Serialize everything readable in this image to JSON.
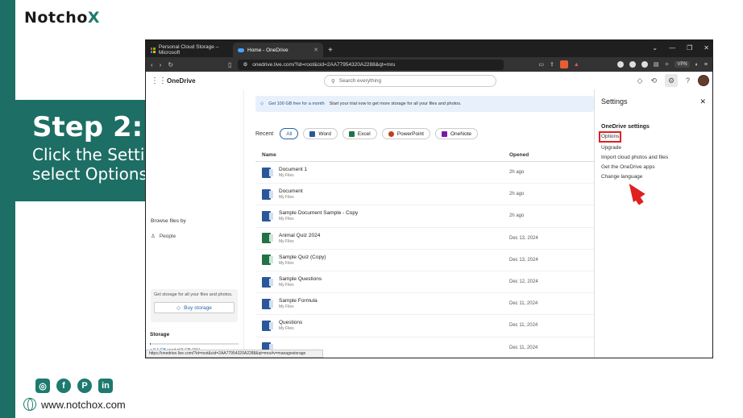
{
  "brand": {
    "name_prefix": "Notcho",
    "name_suffix": "X"
  },
  "step": {
    "title": "Step 2:",
    "description": "Click the Settings and select Options"
  },
  "social": {
    "icons": [
      "instagram-icon",
      "facebook-icon",
      "pinterest-icon",
      "linkedin-icon"
    ],
    "pinterest_glyph": "P",
    "linkedin_glyph": "in",
    "instagram_glyph": "◎",
    "facebook_glyph": "f"
  },
  "website": "www.notchox.com",
  "browser": {
    "tabs": [
      {
        "label": "Personal Cloud Storage – Microsoft"
      },
      {
        "label": "Home - OneDrive"
      }
    ],
    "new_tab": "+",
    "url": "onedrive.live.com/?id=root&cid=2AA77954320A2288&qt=mru",
    "vpn": "VPN",
    "status_url": "https://onedrive.live.com/?id=root&cid=2AA77954320A2288&qt=mru#v=managestorage"
  },
  "onedrive": {
    "app_title": "OneDrive",
    "search_placeholder": "Search everything",
    "banner": {
      "highlight": "Get 100 GB free for a month",
      "text": "Start your trial now to get more storage for all your files and photos."
    },
    "filters": {
      "recent_label": "Recent",
      "chips": [
        {
          "label": "All",
          "color": ""
        },
        {
          "label": "Word",
          "color": "#2b579a"
        },
        {
          "label": "Excel",
          "color": "#217346"
        },
        {
          "label": "PowerPoint",
          "color": "#c43e1c"
        },
        {
          "label": "OneNote",
          "color": "#7719aa"
        }
      ]
    },
    "columns": {
      "name": "Name",
      "opened": "Opened"
    },
    "files": [
      {
        "name": "Document 1",
        "location": "My Files",
        "opened": "2h ago",
        "type": "word"
      },
      {
        "name": "Document",
        "location": "My Files",
        "opened": "2h ago",
        "type": "word"
      },
      {
        "name": "Sample Document Sample - Copy",
        "location": "My Files",
        "opened": "2h ago",
        "type": "word"
      },
      {
        "name": "Animal Quiz 2024",
        "location": "My Files",
        "opened": "Dec 13, 2024",
        "type": "excel"
      },
      {
        "name": "Sample Quiz (Copy)",
        "location": "My Files",
        "opened": "Dec 13, 2024",
        "type": "excel"
      },
      {
        "name": "Sample Questions",
        "location": "My Files",
        "opened": "Dec 12, 2024",
        "type": "word"
      },
      {
        "name": "Sample Formula",
        "location": "My Files",
        "opened": "Dec 11, 2024",
        "type": "word"
      },
      {
        "name": "Questions",
        "location": "My Files",
        "opened": "Dec 11, 2024",
        "type": "word"
      },
      {
        "name": "",
        "location": "",
        "opened": "Dec 11, 2024",
        "type": "word"
      }
    ],
    "sidebar": {
      "browse_heading": "Browse files by",
      "people": "People",
      "storage_promo": "Get storage for all your files and photos.",
      "buy_storage": "Buy storage",
      "storage_label": "Storage",
      "storage_used_link": "< 0.1 GB",
      "storage_used_text": "used of 5 GB (1%)",
      "storage_used_fraction": 0.01
    },
    "settings_panel": {
      "title": "Settings",
      "section": "OneDrive settings",
      "options": [
        "Options",
        "Upgrade",
        "Import cloud photos and files",
        "Get the OneDrive apps",
        "Change language"
      ]
    }
  }
}
